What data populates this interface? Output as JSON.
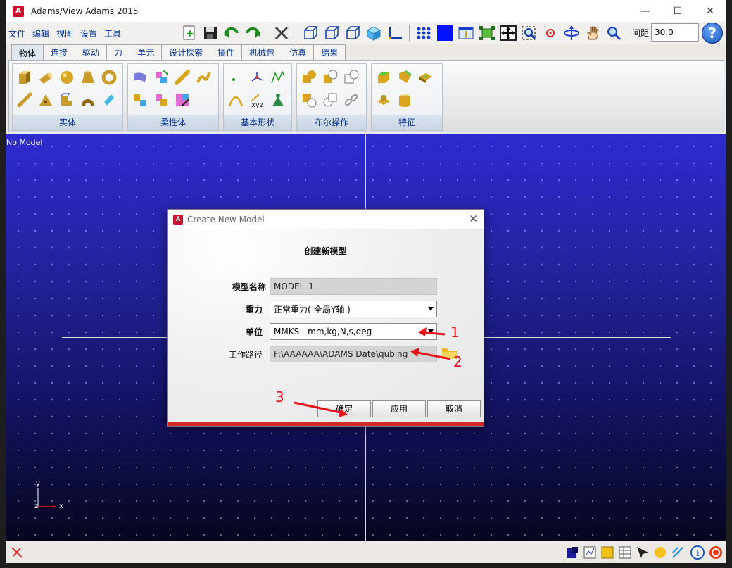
{
  "window": {
    "title": "Adams/View Adams 2015",
    "icon": "A"
  },
  "menu": [
    "文件",
    "编辑",
    "视图",
    "设置",
    "工具"
  ],
  "toolbar": {
    "spacing_label": "间距",
    "spacing_value": "30.0",
    "help": "?"
  },
  "tabs": [
    "物体",
    "连接",
    "驱动",
    "力",
    "单元",
    "设计探索",
    "插件",
    "机械包",
    "仿真",
    "结果"
  ],
  "ribbon_groups": [
    "实体",
    "柔性体",
    "基本形状",
    "布尔操作",
    "特征"
  ],
  "viewport": {
    "status": "No Model",
    "axis_y": "y",
    "axis_z": "z",
    "axis_x": "x",
    "label_xyz": "xyz"
  },
  "dialog": {
    "title": "Create New Model",
    "icon": "A",
    "heading": "创建新模型",
    "model_name_label": "模型名称",
    "model_name_value": "MODEL_1",
    "gravity_label": "重力",
    "gravity_value": "正常重力(-全局Y轴 )",
    "units_label": "单位",
    "units_value": "MMKS - mm,kg,N,s,deg",
    "workdir_label": "工作路径",
    "workdir_value": "F:\\AAAAAA\\ADAMS Date\\qubing",
    "ok_label": "确定",
    "apply_label": "应用",
    "cancel_label": "取消"
  },
  "annotations": [
    "1",
    "2",
    "3"
  ],
  "colors": {
    "accent_red": "#e8131a",
    "viewport_top": "#2e2bd1",
    "menu_text": "#00339a"
  }
}
